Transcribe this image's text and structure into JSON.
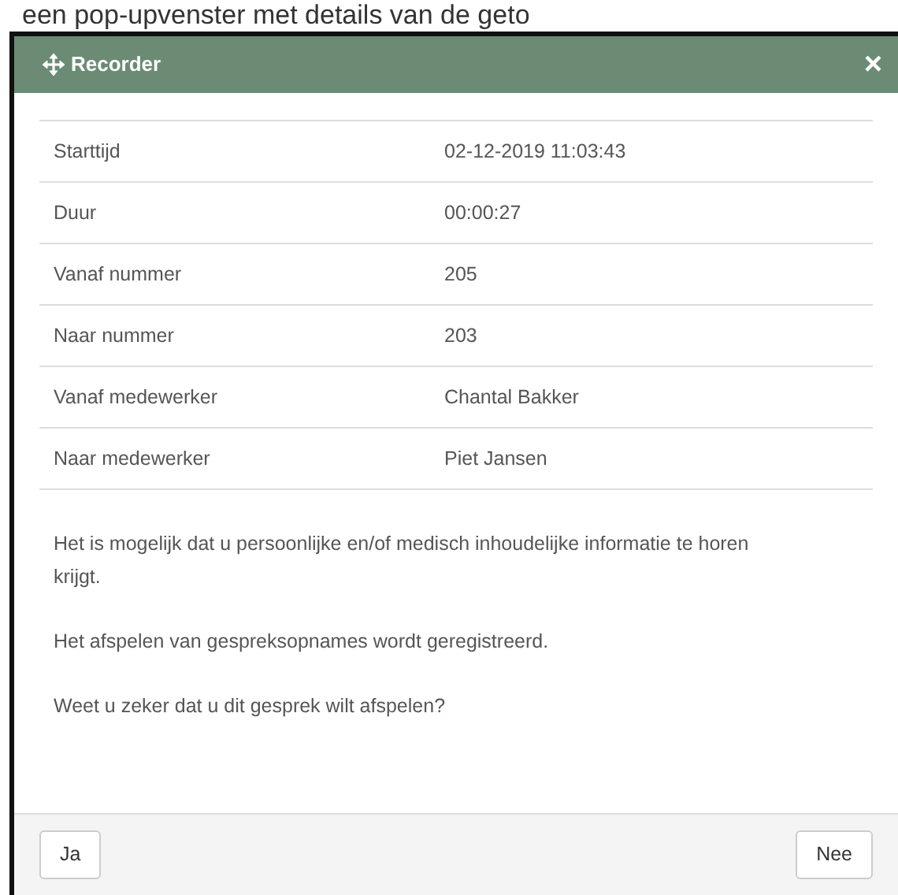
{
  "background_text": "een pop-upvenster met details van de geto",
  "dialog": {
    "title": "Recorder",
    "close": "×"
  },
  "details": [
    {
      "label": "Starttijd",
      "value": "02-12-2019 11:03:43"
    },
    {
      "label": "Duur",
      "value": "00:00:27"
    },
    {
      "label": "Vanaf nummer",
      "value": "205"
    },
    {
      "label": "Naar nummer",
      "value": "203"
    },
    {
      "label": "Vanaf medewerker",
      "value": "Chantal Bakker"
    },
    {
      "label": "Naar medewerker",
      "value": "Piet Jansen"
    }
  ],
  "messages": [
    "Het is mogelijk dat u persoonlijke en/of medisch inhoudelijke informatie te horen krijgt.",
    "Het afspelen van gespreksopnames wordt geregistreerd.",
    "Weet u zeker dat u dit gesprek wilt afspelen?"
  ],
  "buttons": [
    "Ja",
    "Nee"
  ]
}
